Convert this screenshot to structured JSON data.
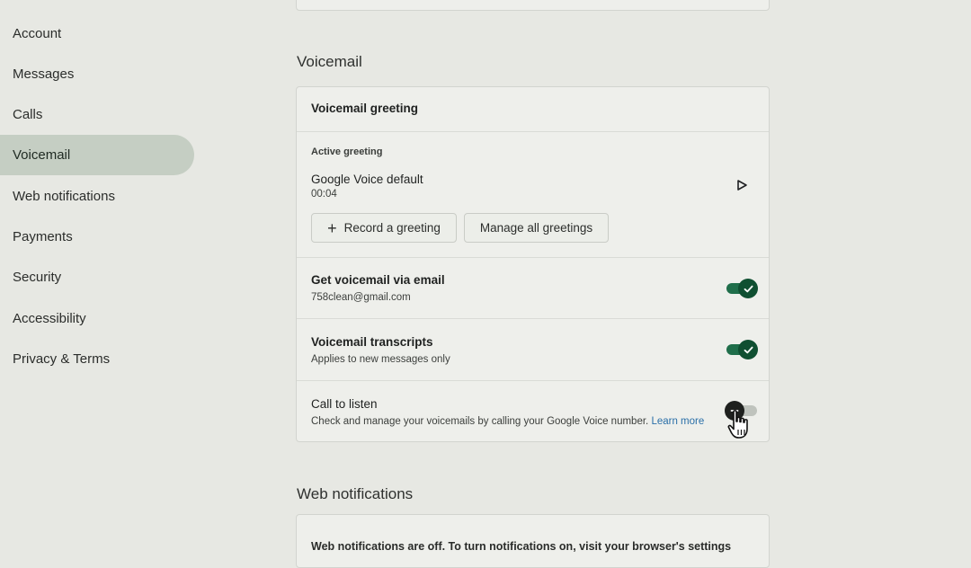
{
  "sidebar": {
    "items": [
      {
        "label": "Account",
        "active": false
      },
      {
        "label": "Messages",
        "active": false
      },
      {
        "label": "Calls",
        "active": false
      },
      {
        "label": "Voicemail",
        "active": true
      },
      {
        "label": "Web notifications",
        "active": false
      },
      {
        "label": "Payments",
        "active": false
      },
      {
        "label": "Security",
        "active": false
      },
      {
        "label": "Accessibility",
        "active": false
      },
      {
        "label": "Privacy & Terms",
        "active": false
      }
    ]
  },
  "voicemail": {
    "section_title": "Voicemail",
    "greeting_header": "Voicemail greeting",
    "active_greeting_label": "Active greeting",
    "greeting_name": "Google Voice default",
    "greeting_duration": "00:04",
    "record_button": "Record a greeting",
    "manage_button": "Manage all greetings",
    "email": {
      "title": "Get voicemail via email",
      "subtitle": "758clean@gmail.com",
      "enabled": true
    },
    "transcripts": {
      "title": "Voicemail transcripts",
      "subtitle": "Applies to new messages only",
      "enabled": true
    },
    "call_to_listen": {
      "title": "Call to listen",
      "subtitle": "Check and manage your voicemails by calling your Google Voice number.",
      "link": "Learn more",
      "enabled": false
    }
  },
  "web_notifications": {
    "section_title": "Web notifications",
    "text": "Web notifications are off. To turn notifications on, visit your browser's settings"
  },
  "colors": {
    "accent_green": "#1f6e4a",
    "active_nav_bg": "#c5cec3",
    "link": "#2a6fa8"
  },
  "icons": [
    "play-icon",
    "plus-icon",
    "check-icon",
    "minus-icon",
    "hand-cursor-icon"
  ]
}
